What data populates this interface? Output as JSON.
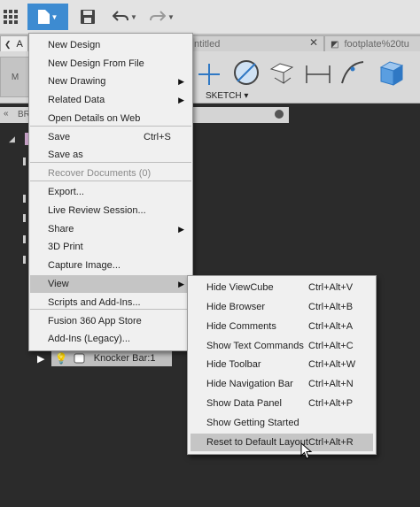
{
  "tabs": [
    {
      "label": "A"
    },
    {
      "label": "ntitled",
      "close": "✕"
    },
    {
      "label": "footplate%20tu"
    }
  ],
  "ribbon": {
    "mode_label": "M",
    "sketch_label": "SKETCH ▾"
  },
  "browser": {
    "title": "BR"
  },
  "tree": {
    "knocker_label": "Knocker Bar:1"
  },
  "file_menu": {
    "items": [
      {
        "label": "New Design"
      },
      {
        "label": "New Design From File"
      },
      {
        "label": "New Drawing",
        "submenu": true
      },
      {
        "label": "Related Data",
        "submenu": true
      },
      {
        "label": "Open Details on Web"
      },
      {
        "label": "Save",
        "shortcut": "Ctrl+S"
      },
      {
        "label": "Save as"
      },
      {
        "label": "Recover Documents (0)",
        "disabled": true
      },
      {
        "label": "Export..."
      },
      {
        "label": "Live Review Session..."
      },
      {
        "label": "Share",
        "submenu": true
      },
      {
        "label": "3D Print"
      },
      {
        "label": "Capture Image..."
      },
      {
        "label": "View",
        "submenu": true,
        "active": true
      },
      {
        "label": "Scripts and Add-Ins..."
      },
      {
        "label": "Fusion 360 App Store"
      },
      {
        "label": "Add-Ins (Legacy)..."
      }
    ]
  },
  "view_menu": {
    "items": [
      {
        "label": "Hide ViewCube",
        "shortcut": "Ctrl+Alt+V"
      },
      {
        "label": "Hide Browser",
        "shortcut": "Ctrl+Alt+B"
      },
      {
        "label": "Hide Comments",
        "shortcut": "Ctrl+Alt+A"
      },
      {
        "label": "Show Text Commands",
        "shortcut": "Ctrl+Alt+C"
      },
      {
        "label": "Hide Toolbar",
        "shortcut": "Ctrl+Alt+W"
      },
      {
        "label": "Hide Navigation Bar",
        "shortcut": "Ctrl+Alt+N"
      },
      {
        "label": "Show Data Panel",
        "shortcut": "Ctrl+Alt+P"
      },
      {
        "label": "Show Getting Started",
        "shortcut": ""
      },
      {
        "label": "Reset to Default Layout",
        "shortcut": "Ctrl+Alt+R",
        "hover": true
      }
    ]
  },
  "colors": {
    "accent": "#3d8bd1",
    "menu_bg": "#f0f0f0",
    "hover": "#c5c5c5",
    "canvas": "#2b2b2b"
  }
}
